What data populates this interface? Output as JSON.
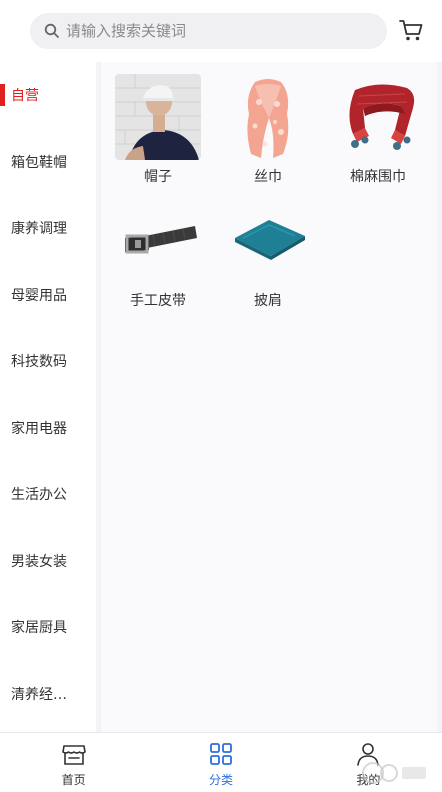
{
  "search": {
    "placeholder": "请输入搜索关键词"
  },
  "sidebar": {
    "items": [
      {
        "label": "自营",
        "active": true
      },
      {
        "label": "箱包鞋帽"
      },
      {
        "label": "康养调理"
      },
      {
        "label": "母婴用品"
      },
      {
        "label": "科技数码"
      },
      {
        "label": "家用电器"
      },
      {
        "label": "生活办公"
      },
      {
        "label": "男装女装"
      },
      {
        "label": "家居厨具"
      },
      {
        "label": "清养经…"
      }
    ]
  },
  "products": [
    {
      "label": "帽子",
      "icon": "hat-photo"
    },
    {
      "label": "丝巾",
      "icon": "silk-scarf-photo"
    },
    {
      "label": "棉麻围巾",
      "icon": "cotton-scarf-photo"
    },
    {
      "label": "手工皮带",
      "icon": "leather-belt-photo"
    },
    {
      "label": "披肩",
      "icon": "shawl-photo"
    }
  ],
  "tabbar": {
    "items": [
      {
        "label": "首页",
        "icon": "store-icon"
      },
      {
        "label": "分类",
        "icon": "category-grid-icon",
        "active": true
      },
      {
        "label": "我的",
        "icon": "user-icon"
      }
    ]
  },
  "colors": {
    "accent_red": "#e02020",
    "accent_blue": "#2b6fe0",
    "search_bg": "#f0f0f2"
  }
}
